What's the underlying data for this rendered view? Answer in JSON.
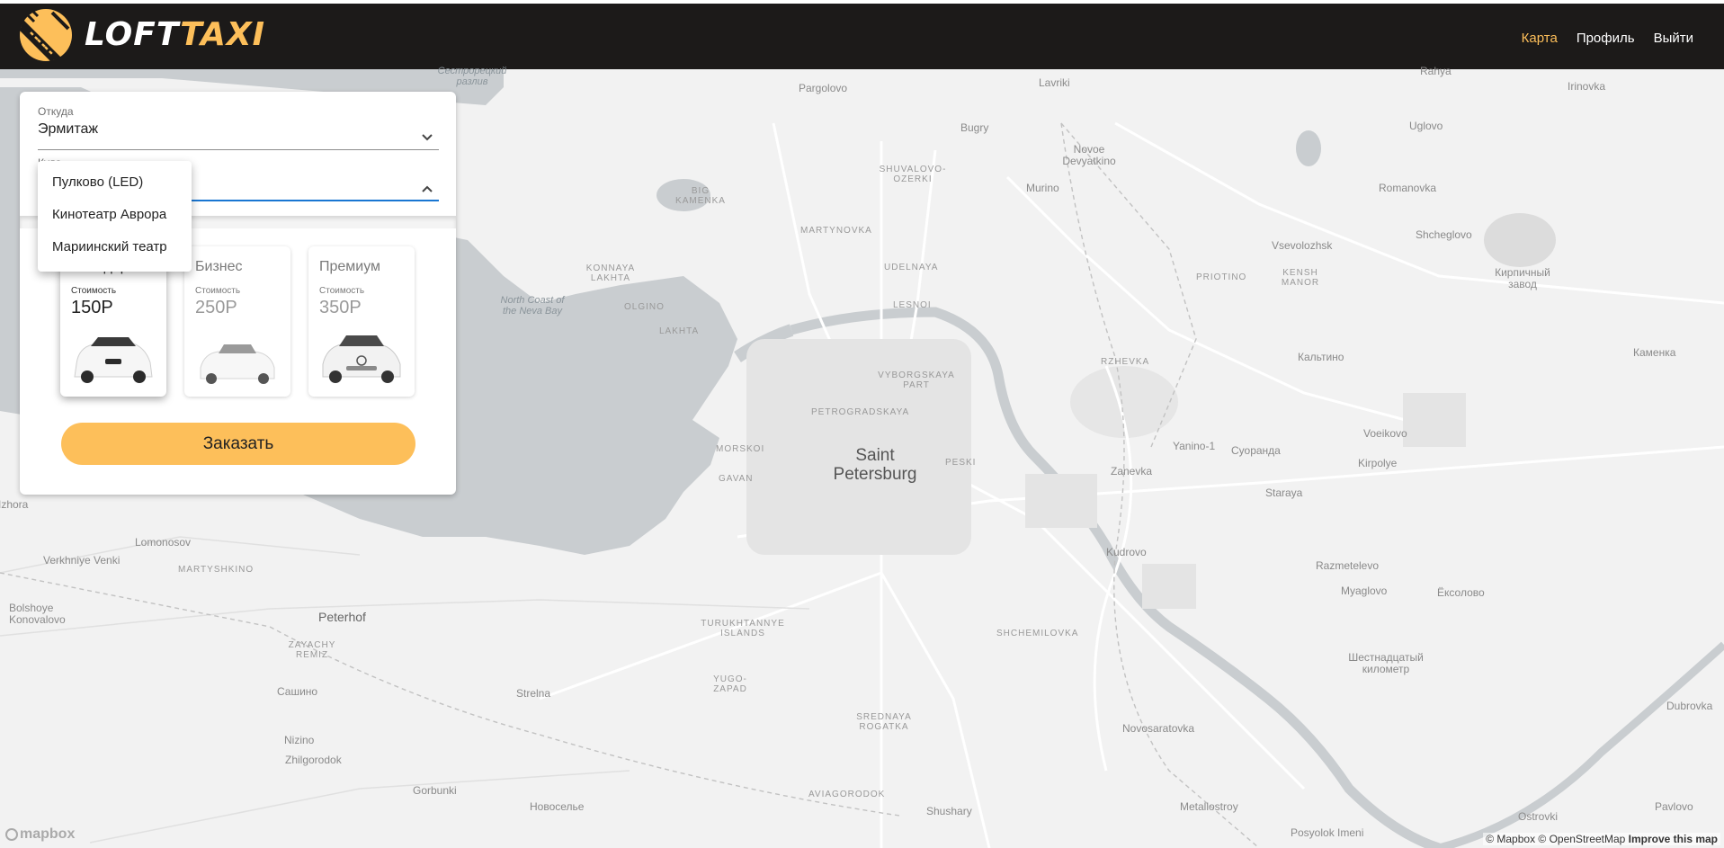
{
  "header": {
    "logo": {
      "text_a": "LOFT",
      "text_b": "TAXI"
    },
    "nav": [
      {
        "label": "Карта",
        "active": true
      },
      {
        "label": "Профиль",
        "active": false
      },
      {
        "label": "Выйти",
        "active": false
      }
    ]
  },
  "order": {
    "from": {
      "label": "Откуда",
      "value": "Эрмитаж"
    },
    "to": {
      "label": "Куда",
      "value": ""
    },
    "tariffs": [
      {
        "title": "Стандарт",
        "cost_label": "Стоимость",
        "price": "150Р",
        "selected": true
      },
      {
        "title": "Бизнес",
        "cost_label": "Стоимость",
        "price": "250Р",
        "selected": false
      },
      {
        "title": "Премиум",
        "cost_label": "Стоимость",
        "price": "350Р",
        "selected": false
      }
    ],
    "order_button": "Заказать",
    "dropdown_options": [
      "Пулково (LED)",
      "Кинотеатр Аврора",
      "Мариинский театр"
    ]
  },
  "map": {
    "city": "Saint Petersburg",
    "places": [
      "Сестрорецкий разлив",
      "Pargolovo",
      "Lavriki",
      "Rahya",
      "Irinovka",
      "Bugry",
      "Novoe Devyatkino",
      "Uglovo",
      "SHUVALOVO-OZERKI",
      "Murino",
      "Romanovka",
      "BIG KAMENKA",
      "MARTYNOVKA",
      "Vsevolozhsk",
      "Shcheglovo",
      "KONNAYA LAKHTA",
      "UDELNAYA",
      "PRIOTINO",
      "KENSH MANOR",
      "Кирпичный завод",
      "North Coast of the Neva Bay",
      "OLGINO",
      "LAKHTA",
      "LESNOI",
      "Кальтино",
      "Каменка",
      "RZHEVKA",
      "VYBORGSKAYA PART",
      "PETROGRADSKAYA",
      "MORSKOI",
      "Voeikovo",
      "Yanino-1",
      "Суоранда",
      "PESKI",
      "Kirpolye",
      "GAVAN",
      "Zanevka",
      "Staraya",
      "Lomonosov",
      "Kudrovo",
      "Verkhniye Venki",
      "MARTYSHKINO",
      "Razmetelevo",
      "Myaglovo",
      "Ёксолово",
      "Bolshoye Konovalovo",
      "Peterhof",
      "TURUKHTANNYE ISLANDS",
      "SHCHEMILOVKA",
      "Шестнадцатый километр",
      "ZAYACHY REMIZ",
      "Сашино",
      "Strelna",
      "YUGO-ZAPAD",
      "Dubrovka",
      "SREDNAYA ROGATKA",
      "Novosaratovka",
      "Nizino",
      "Zhilgorodok",
      "Gorbunki",
      "Новоселье",
      "AVIAGORODOK",
      "Shushary",
      "Metallostroy",
      "Ostrovki",
      "Pavlovo",
      "Posyolok Imeni",
      "Izhora"
    ],
    "attribution": "© Mapbox © OpenStreetMap",
    "improve": "Improve this map",
    "mapbox_logo": "mapbox"
  }
}
